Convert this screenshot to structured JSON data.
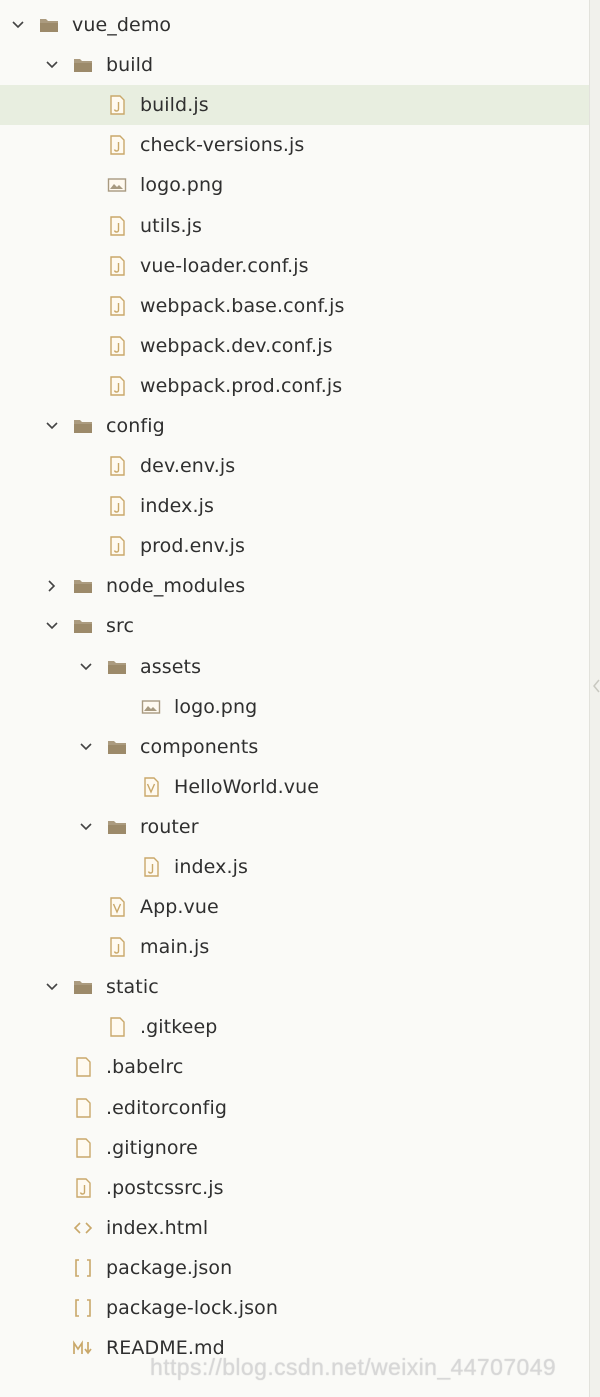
{
  "colors": {
    "folder": "#9c8a6a",
    "file_icon": "#c9a86a",
    "text": "#2f2f2f",
    "selected_bg": "#e8eee0"
  },
  "tree": [
    {
      "label": "vue_demo",
      "depth": 0,
      "type": "folder",
      "expanded": true,
      "name": "vue-demo"
    },
    {
      "label": "build",
      "depth": 1,
      "type": "folder",
      "expanded": true,
      "name": "build"
    },
    {
      "label": "build.js",
      "depth": 2,
      "type": "js",
      "selected": true,
      "name": "build-js"
    },
    {
      "label": "check-versions.js",
      "depth": 2,
      "type": "js",
      "name": "check-versions-js"
    },
    {
      "label": "logo.png",
      "depth": 2,
      "type": "image",
      "name": "build-logo-png"
    },
    {
      "label": "utils.js",
      "depth": 2,
      "type": "js",
      "name": "utils-js"
    },
    {
      "label": "vue-loader.conf.js",
      "depth": 2,
      "type": "js",
      "name": "vue-loader-conf-js"
    },
    {
      "label": "webpack.base.conf.js",
      "depth": 2,
      "type": "js",
      "name": "webpack-base-conf-js"
    },
    {
      "label": "webpack.dev.conf.js",
      "depth": 2,
      "type": "js",
      "name": "webpack-dev-conf-js"
    },
    {
      "label": "webpack.prod.conf.js",
      "depth": 2,
      "type": "js",
      "name": "webpack-prod-conf-js"
    },
    {
      "label": "config",
      "depth": 1,
      "type": "folder",
      "expanded": true,
      "name": "config"
    },
    {
      "label": "dev.env.js",
      "depth": 2,
      "type": "js",
      "name": "dev-env-js"
    },
    {
      "label": "index.js",
      "depth": 2,
      "type": "js",
      "name": "config-index-js"
    },
    {
      "label": "prod.env.js",
      "depth": 2,
      "type": "js",
      "name": "prod-env-js"
    },
    {
      "label": "node_modules",
      "depth": 1,
      "type": "folder",
      "expanded": false,
      "name": "node-modules"
    },
    {
      "label": "src",
      "depth": 1,
      "type": "folder",
      "expanded": true,
      "name": "src"
    },
    {
      "label": "assets",
      "depth": 2,
      "type": "folder",
      "expanded": true,
      "name": "assets"
    },
    {
      "label": "logo.png",
      "depth": 3,
      "type": "image",
      "name": "assets-logo-png"
    },
    {
      "label": "components",
      "depth": 2,
      "type": "folder",
      "expanded": true,
      "name": "components"
    },
    {
      "label": "HelloWorld.vue",
      "depth": 3,
      "type": "vue",
      "name": "helloworld-vue"
    },
    {
      "label": "router",
      "depth": 2,
      "type": "folder",
      "expanded": true,
      "name": "router"
    },
    {
      "label": "index.js",
      "depth": 3,
      "type": "js",
      "name": "router-index-js"
    },
    {
      "label": "App.vue",
      "depth": 2,
      "type": "vue",
      "name": "app-vue"
    },
    {
      "label": "main.js",
      "depth": 2,
      "type": "js",
      "name": "main-js"
    },
    {
      "label": "static",
      "depth": 1,
      "type": "folder",
      "expanded": true,
      "name": "static"
    },
    {
      "label": ".gitkeep",
      "depth": 2,
      "type": "plain",
      "name": "gitkeep"
    },
    {
      "label": ".babelrc",
      "depth": 1,
      "type": "plain",
      "name": "babelrc"
    },
    {
      "label": ".editorconfig",
      "depth": 1,
      "type": "plain",
      "name": "editorconfig"
    },
    {
      "label": ".gitignore",
      "depth": 1,
      "type": "plain",
      "name": "gitignore"
    },
    {
      "label": ".postcssrc.js",
      "depth": 1,
      "type": "js",
      "name": "postcssrc-js"
    },
    {
      "label": "index.html",
      "depth": 1,
      "type": "html",
      "name": "index-html"
    },
    {
      "label": "package.json",
      "depth": 1,
      "type": "json",
      "name": "package-json"
    },
    {
      "label": "package-lock.json",
      "depth": 1,
      "type": "json",
      "name": "package-lock-json"
    },
    {
      "label": "README.md",
      "depth": 1,
      "type": "md",
      "name": "readme-md"
    }
  ],
  "watermark": "https://blog.csdn.net/weixin_44707049"
}
